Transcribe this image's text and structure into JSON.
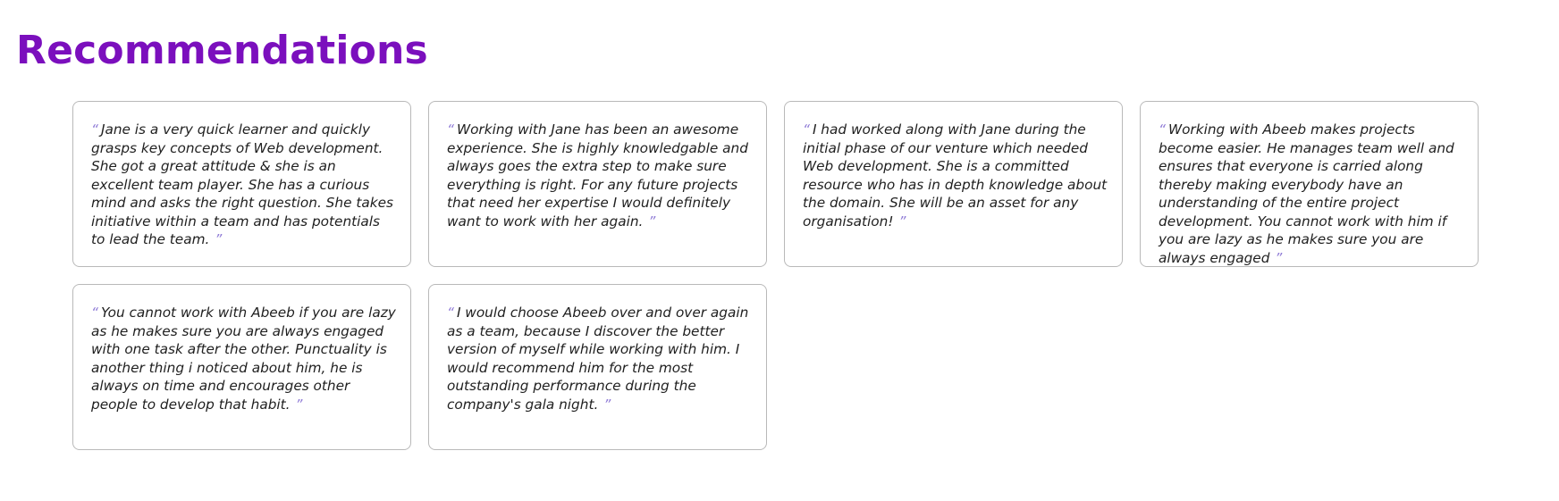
{
  "section": {
    "title": "Recommendations"
  },
  "quote_marks": {
    "open": "“",
    "close": "”",
    "color": "#8f7bd6"
  },
  "colors": {
    "heading": "#7b0fbd",
    "card_border": "#b9b9b9",
    "text": "#1f1f1f"
  },
  "recommendations": [
    {
      "text": "Jane is a very quick learner and quickly grasps key concepts of Web development. She got a great attitude & she is an excellent team player. She has a curious mind and asks the right question. She takes initiative within a team and has potentials to lead the team."
    },
    {
      "text": "Working with Jane has been an awesome experience. She is highly knowledgable and always goes the extra step to make sure everything is right. For any future projects that need her expertise I would definitely want to work with her again."
    },
    {
      "text": "I had worked along with Jane during the initial phase of our venture which needed Web development. She is a committed resource who has in depth knowledge about the domain. She will be an asset for any organisation!"
    },
    {
      "text": "Working with Abeeb makes projects become easier. He manages team well and ensures that everyone is carried along thereby making everybody have an understanding of the entire project development. You cannot work with him if you are lazy as he makes sure you are always engaged"
    },
    {
      "text": "You cannot work with Abeeb if you are lazy as he makes sure you are always engaged with one task after the other. Punctuality is another thing i noticed about him, he is always on time and encourages other people to develop that habit."
    },
    {
      "text": "I would choose Abeeb over and over again as a team, because I discover the better version of myself while working with him. I would recommend him for the most outstanding performance during the company's gala night."
    }
  ]
}
